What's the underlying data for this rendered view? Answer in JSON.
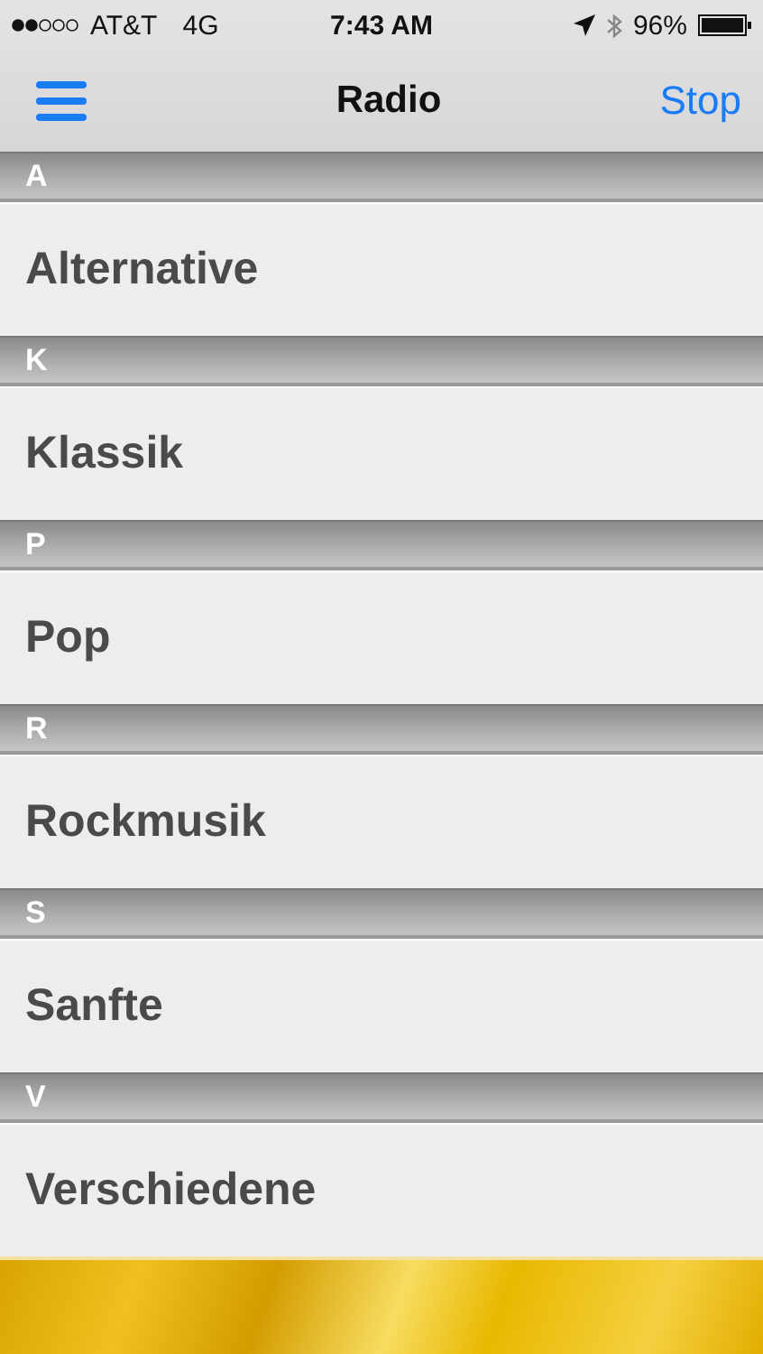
{
  "status_bar": {
    "carrier": "AT&T",
    "network": "4G",
    "time": "7:43 AM",
    "battery": "96%"
  },
  "nav": {
    "title": "Radio",
    "action": "Stop"
  },
  "sections": [
    {
      "letter": "A",
      "items": [
        "Alternative"
      ]
    },
    {
      "letter": "K",
      "items": [
        "Klassik"
      ]
    },
    {
      "letter": "P",
      "items": [
        "Pop"
      ]
    },
    {
      "letter": "R",
      "items": [
        "Rockmusik"
      ]
    },
    {
      "letter": "S",
      "items": [
        "Sanfte"
      ]
    },
    {
      "letter": "V",
      "items": [
        "Verschiedene"
      ]
    }
  ]
}
